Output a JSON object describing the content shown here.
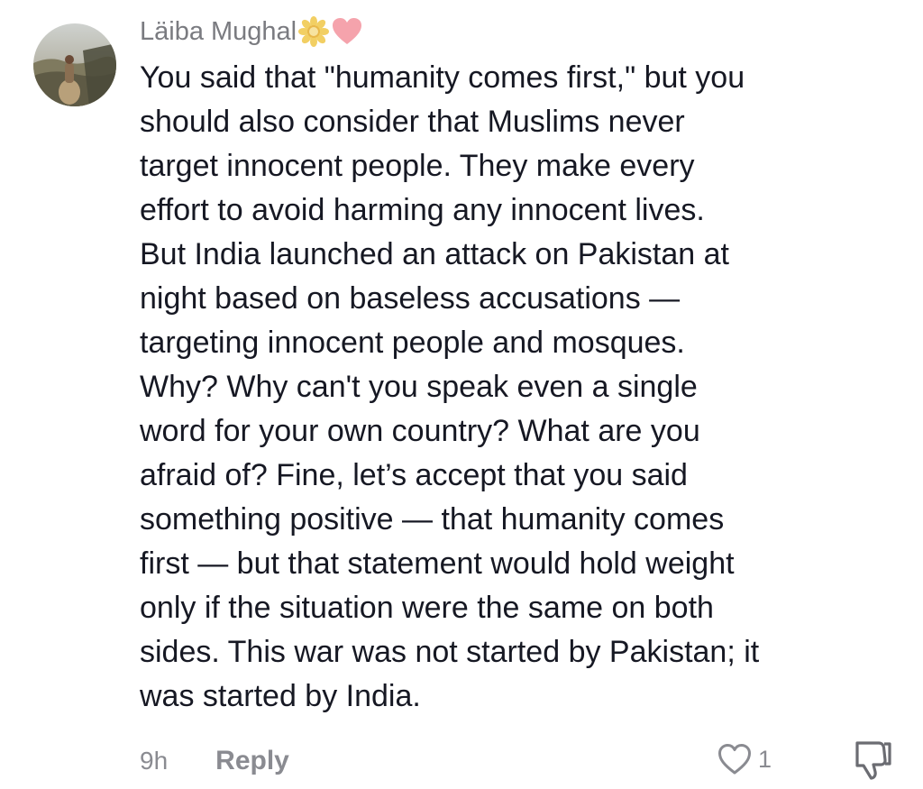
{
  "comment": {
    "username": "Läiba Mughal",
    "username_emojis": [
      "sunflower-icon",
      "pink-heart-icon"
    ],
    "avatar_icon": "profile-photo-woman-landscape",
    "body_lines": [
      "You said that \"humanity comes first,\" but you",
      "should also consider that Muslims never",
      "target innocent people. They make every",
      "effort to avoid harming any innocent lives.",
      "But India launched an attack on Pakistan at",
      "night based on baseless accusations —",
      "targeting innocent people and mosques.",
      "Why? Why can't you speak even a single",
      "word for your own country? What are you",
      "afraid of? Fine, let’s accept that you said",
      "something positive — that humanity comes",
      "first — but that statement would hold weight",
      "only if the situation were the same on both",
      "sides. This war was not started by Pakistan; it",
      "was started by India."
    ],
    "timestamp": "9h",
    "reply_label": "Reply",
    "like_count": "1",
    "like_icon": "heart-outline-icon",
    "dislike_icon": "thumbs-down-icon"
  },
  "colors": {
    "text_primary": "#161823",
    "text_secondary": "#8a8b91",
    "username": "#7a7b80",
    "background": "#ffffff",
    "emoji_heart": "#f5a3ac",
    "emoji_sunflower": "#f2cf63"
  }
}
